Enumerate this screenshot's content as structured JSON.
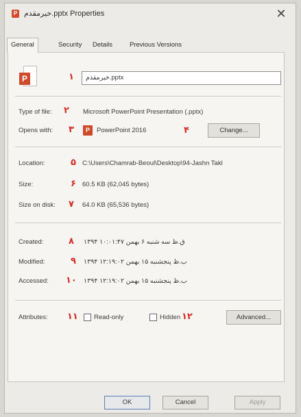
{
  "window": {
    "title": "خیرمقدم.pptx Properties",
    "close_glyph": "✕"
  },
  "tabs": [
    {
      "label": "General"
    },
    {
      "label": "Security"
    },
    {
      "label": "Details"
    },
    {
      "label": "Previous Versions"
    }
  ],
  "file": {
    "name_value": "خیرمقدم.pptx",
    "type_label": "Type of file:",
    "type_value": "Microsoft PowerPoint Presentation (.pptx)",
    "opens_label": "Opens with:",
    "opens_value": "PowerPoint 2016",
    "change_label": "Change...",
    "location_label": "Location:",
    "location_value": "C:\\Users\\Chamrab-Beoul\\Desktop\\94-Jashn Takl",
    "size_label": "Size:",
    "size_value": "60.5 KB (62,045 bytes)",
    "size_disk_label": "Size on disk:",
    "size_disk_value": "64.0 KB (65,536 bytes)"
  },
  "dates": {
    "created_label": "Created:",
    "created_value": "۱۳۹۴ ق.ظ سه شنبه ۶ بهمن ۱۰:۰۱:۴۷",
    "modified_label": "Modified:",
    "modified_value": "۱۳۹۴ ب.ظ پنجشنبه ۱۵ بهمن ۱۲:۱۹:۰۲",
    "accessed_label": "Accessed:",
    "accessed_value": "۱۳۹۴ ب.ظ پنجشنبه ۱۵ بهمن ۱۲:۱۹:۰۲"
  },
  "attributes": {
    "label": "Attributes:",
    "readonly_label": "Read-only",
    "hidden_label": "Hidden",
    "advanced_label": "Advanced..."
  },
  "annotations": {
    "n1": "۱",
    "n2": "۲",
    "n3": "۳",
    "n4": "۴",
    "n5": "۵",
    "n6": "۶",
    "n7": "۷",
    "n8": "۸",
    "n9": "۹",
    "n10": "۱۰",
    "n11": "۱۱",
    "n12": "۱۲"
  },
  "footer": {
    "ok_label": "OK",
    "cancel_label": "Cancel",
    "apply_label": "Apply"
  },
  "colors": {
    "annotation": "#d42d24",
    "ppt_orange": "#cf4a2b"
  },
  "icons": {
    "file_icon": "powerpoint-file-icon",
    "app_icon": "powerpoint-app-icon"
  }
}
